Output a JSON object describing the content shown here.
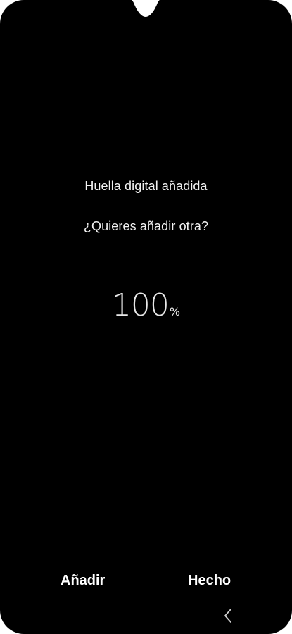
{
  "screen": {
    "title": "Huella digital añadida",
    "question": "¿Quieres añadir otra?"
  },
  "progress": {
    "value": "100",
    "unit": "%"
  },
  "actions": {
    "add_label": "Añadir",
    "done_label": "Hecho"
  },
  "navigation": {
    "back_icon": "chevron-left-icon"
  },
  "colors": {
    "background": "#000000",
    "text": "#f2f2f2"
  }
}
